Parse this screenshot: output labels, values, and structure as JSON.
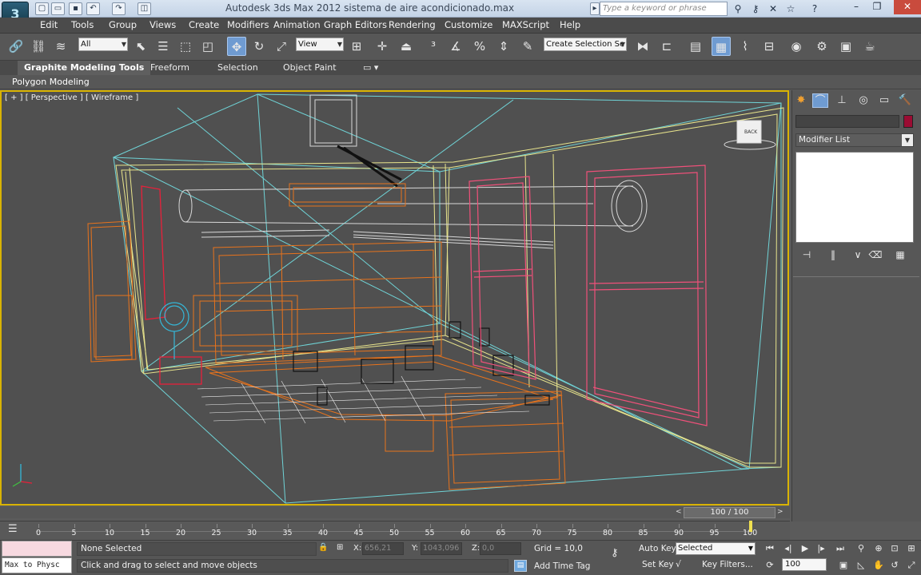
{
  "app": {
    "title": "Autodesk 3ds Max  2012     sistema de aire acondicionado.max",
    "search_placeholder": "Type a keyword or phrase",
    "logo_text": "3",
    "quick_access": [
      "new-icon",
      "open-icon",
      "save-icon",
      "undo-icon",
      "redo-icon",
      "project-icon"
    ],
    "title_tools": [
      "binoculars-icon",
      "key-icon",
      "star-icon",
      "help-icon"
    ],
    "window_controls": [
      "minimize-icon",
      "restore-icon",
      "close-icon"
    ]
  },
  "menu": {
    "items": [
      "Edit",
      "Tools",
      "Group",
      "Views",
      "Create",
      "Modifiers",
      "Animation",
      "Graph Editors",
      "Rendering",
      "Customize",
      "MAXScript",
      "Help"
    ]
  },
  "toolbar": {
    "selection_filter": "All",
    "ref_coord": "View",
    "named_selection_placeholder": "Create Selection Se",
    "icons": [
      "link-icon",
      "unlink-icon",
      "bind-space-warp-icon",
      "select-object-icon",
      "select-by-name-icon",
      "rect-selection-icon",
      "window-crossing-icon",
      "move-icon",
      "rotate-icon",
      "scale-icon",
      "pivot-icon",
      "select-manipulate-icon",
      "keyboard-shortcut-icon",
      "snap-icon",
      "angle-snap-icon",
      "percent-snap-icon",
      "spinner-snap-icon",
      "edit-named-selection-icon",
      "mirror-icon",
      "align-icon",
      "layer-manager-icon",
      "graphite-toggle-icon",
      "curve-editor-icon",
      "schematic-view-icon",
      "material-editor-icon",
      "render-setup-icon",
      "rendered-frame-icon",
      "render-icon"
    ]
  },
  "ribbon": {
    "tabs": [
      "Graphite Modeling Tools",
      "Freeform",
      "Selection",
      "Object Paint"
    ],
    "active_tab": "Graphite Modeling Tools",
    "panel_label": "Polygon Modeling"
  },
  "viewport": {
    "label": "[ + ] [ Perspective ] [ Wireframe ]",
    "viewcube_label": "BACK",
    "colors": {
      "room": "#e8e48c",
      "wall_edge": "#6fd3d6",
      "furniture": "#e8731c",
      "windows": "#f0507a",
      "lamp": "#35b7d8",
      "chair": "#e8203a",
      "ac_unit": "#d8d8d8",
      "black_objects": "#111111",
      "active_border": "#d9b300"
    }
  },
  "command_panel": {
    "tabs": [
      "create-icon",
      "modify-icon",
      "hierarchy-icon",
      "motion-icon",
      "display-icon",
      "utilities-icon"
    ],
    "modifier_list": "Modifier List",
    "object_color": "#9b0c33",
    "stack_tools": [
      "pin-stack-icon",
      "show-end-result-icon",
      "make-unique-icon",
      "remove-modifier-icon",
      "configure-modifier-sets-icon"
    ]
  },
  "timeline": {
    "slider_text": "100 / 100",
    "prev_arrow": "<",
    "next_arrow": ">",
    "ticks": [
      "0",
      "5",
      "10",
      "15",
      "20",
      "25",
      "30",
      "35",
      "40",
      "45",
      "50",
      "55",
      "60",
      "65",
      "70",
      "75",
      "80",
      "85",
      "90",
      "95",
      "100"
    ],
    "current_frame": 100
  },
  "status": {
    "maxscript_listener": "Max to Physc",
    "selection_info": "None Selected",
    "prompt": "Click and drag to select and move objects",
    "x_label": "X:",
    "x_value": "656,21",
    "y_label": "Y:",
    "y_value": "1043,096",
    "z_label": "Z:",
    "z_value": "0,0",
    "grid": "Grid = 10,0",
    "add_time_tag": "Add Time Tag",
    "auto_key": "Auto Key",
    "set_key": "Set Key",
    "key_mode": "Selected",
    "key_filters": "Key Filters...",
    "current_frame": "100",
    "playback_icons": [
      "goto-start-icon",
      "prev-frame-icon",
      "play-icon",
      "next-frame-icon",
      "goto-end-icon"
    ],
    "nav_icons": [
      "zoom-icon",
      "zoom-all-icon",
      "zoom-extents-icon",
      "zoom-extents-all-icon",
      "field-of-view-icon",
      "pan-icon",
      "orbit-icon",
      "maximize-viewport-icon"
    ]
  }
}
